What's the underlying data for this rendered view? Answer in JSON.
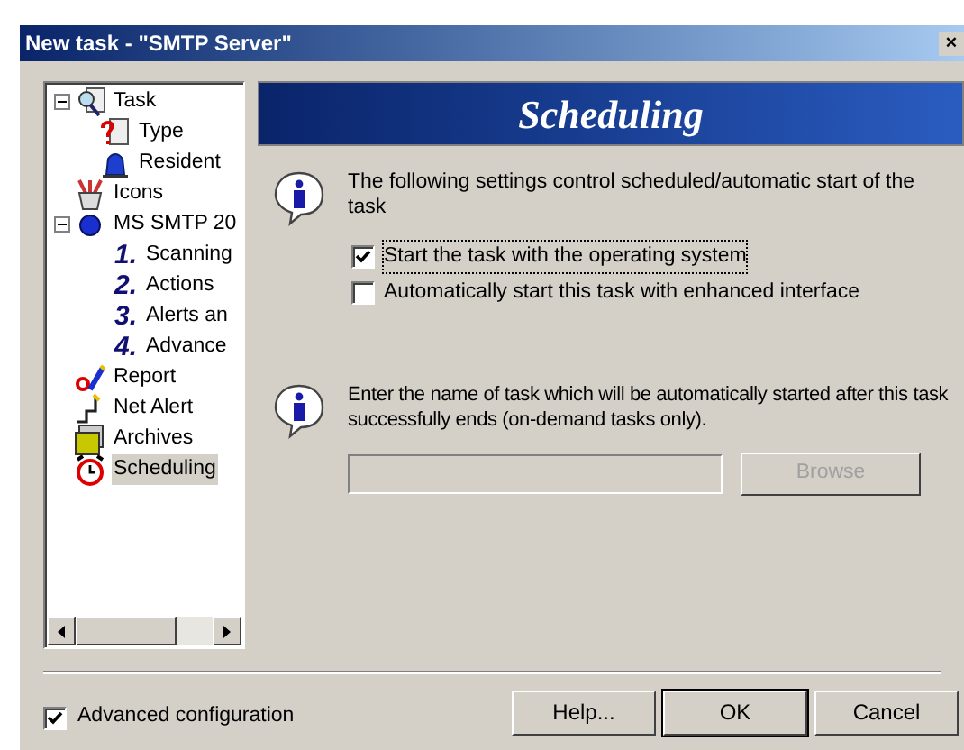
{
  "window": {
    "title": "New task - \"SMTP Server\"",
    "close": "×"
  },
  "tree": {
    "items": [
      {
        "label": "Task",
        "kind": "task",
        "selected": false,
        "expanded": true,
        "children": [
          {
            "label": "Type",
            "kind": "type",
            "selected": false
          },
          {
            "label": "Resident",
            "kind": "resident",
            "selected": false
          }
        ]
      },
      {
        "label": "Icons",
        "kind": "icons",
        "selected": false
      },
      {
        "label": "MS SMTP 20",
        "kind": "globe",
        "selected": false,
        "expanded": true,
        "children": [
          {
            "label": "Scanning",
            "kind": "number",
            "number": "1.",
            "selected": false
          },
          {
            "label": "Actions",
            "kind": "number",
            "number": "2.",
            "selected": false
          },
          {
            "label": "Alerts an",
            "kind": "number",
            "number": "3.",
            "selected": false
          },
          {
            "label": "Advance",
            "kind": "number",
            "number": "4.",
            "selected": false
          }
        ]
      },
      {
        "label": "Report",
        "kind": "report",
        "selected": false
      },
      {
        "label": "Net Alert",
        "kind": "alert",
        "selected": false
      },
      {
        "label": "Archives",
        "kind": "archives",
        "selected": false
      },
      {
        "label": "Scheduling",
        "kind": "clock",
        "selected": true
      }
    ]
  },
  "banner": {
    "title": "Scheduling"
  },
  "info_1": {
    "text": "The following settings control scheduled/automatic start of the task",
    "options": [
      {
        "label": "Start the task with the operating system",
        "checked": true
      },
      {
        "label": "Automatically start this task with enhanced interface",
        "checked": false
      }
    ]
  },
  "info_2": {
    "text": "Enter the name of task which will be automatically started after this task successfully ends (on-demand tasks only).",
    "field_disabled": true,
    "browse": {
      "label": "Browse",
      "disabled": true
    }
  },
  "footer": {
    "advanced": {
      "label": "Advanced configuration",
      "checked": true
    },
    "buttons": [
      {
        "label": "Help...",
        "default": false
      },
      {
        "label": "OK",
        "default": true
      },
      {
        "label": "Cancel",
        "default": false
      }
    ]
  }
}
